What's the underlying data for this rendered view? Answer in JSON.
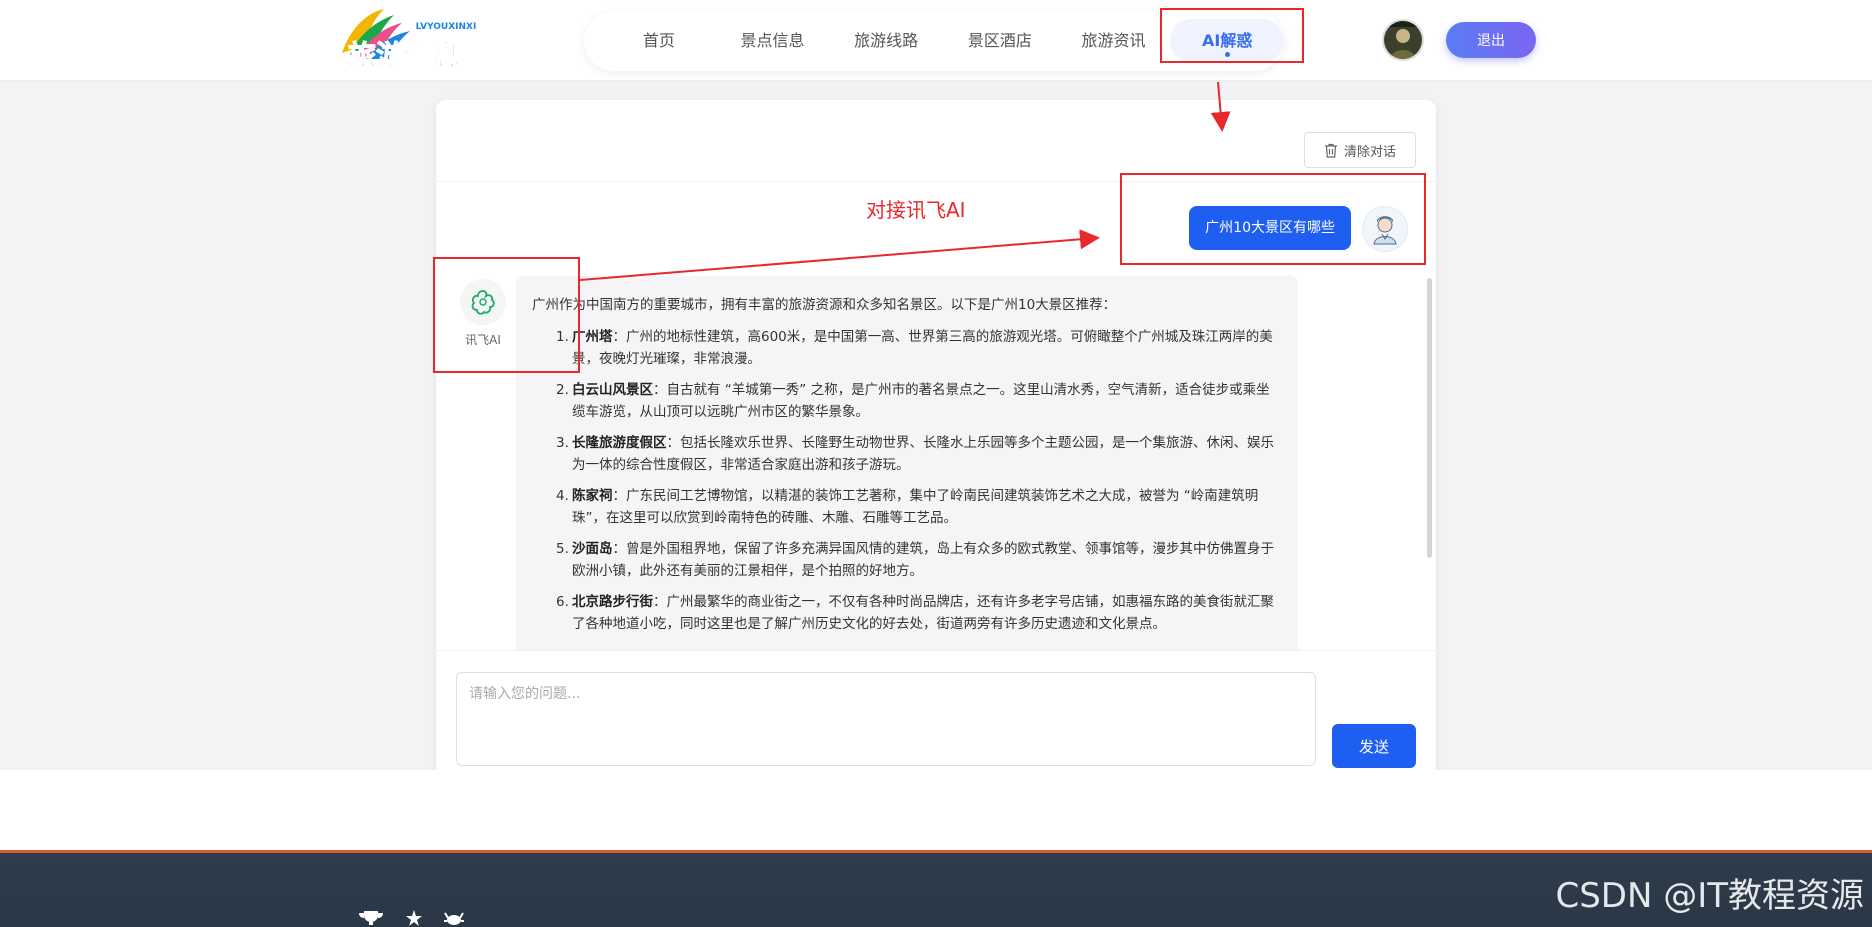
{
  "header": {
    "logo_text": "旅游信息",
    "logo_subtext": "LVYOUXINXI",
    "nav": [
      {
        "label": "首页"
      },
      {
        "label": "景点信息"
      },
      {
        "label": "旅游线路"
      },
      {
        "label": "景区酒店"
      },
      {
        "label": "旅游资讯"
      },
      {
        "label": "AI解惑"
      }
    ],
    "logout_label": "退出"
  },
  "chat": {
    "clear_label": "清除对话",
    "user_message": "广州10大景区有哪些",
    "ai_name": "讯飞AI",
    "ai_intro": "广州作为中国南方的重要城市，拥有丰富的旅游资源和众多知名景区。以下是广州10大景区推荐：",
    "ai_items": [
      {
        "num": "1.",
        "title": "广州塔",
        "text": "：广州的地标性建筑，高600米，是中国第一高、世界第三高的旅游观光塔。可俯瞰整个广州城及珠江两岸的美景，夜晚灯光璀璨，非常浪漫。"
      },
      {
        "num": "2.",
        "title": "白云山风景区",
        "text": "：自古就有 “羊城第一秀” 之称，是广州市的著名景点之一。这里山清水秀，空气清新，适合徒步或乘坐缆车游览，从山顶可以远眺广州市区的繁华景象。"
      },
      {
        "num": "3.",
        "title": "长隆旅游度假区",
        "text": "：包括长隆欢乐世界、长隆野生动物世界、长隆水上乐园等多个主题公园，是一个集旅游、休闲、娱乐为一体的综合性度假区，非常适合家庭出游和孩子游玩。"
      },
      {
        "num": "4.",
        "title": "陈家祠",
        "text": "：广东民间工艺博物馆，以精湛的装饰工艺著称，集中了岭南民间建筑装饰艺术之大成，被誉为 “岭南建筑明珠”，在这里可以欣赏到岭南特色的砖雕、木雕、石雕等工艺品。"
      },
      {
        "num": "5.",
        "title": "沙面岛",
        "text": "：曾是外国租界地，保留了许多充满异国风情的建筑，岛上有众多的欧式教堂、领事馆等，漫步其中仿佛置身于欧洲小镇，此外还有美丽的江景相伴，是个拍照的好地方。"
      },
      {
        "num": "6.",
        "title": "北京路步行街",
        "text": "：广州最繁华的商业街之一，不仅有各种时尚品牌店，还有许多老字号店铺，如惠福东路的美食街就汇聚了各种地道小吃，同时这里也是了解广州历史文化的好去处，街道两旁有许多历史遗迹和文化景点。"
      }
    ],
    "input_placeholder": "请输入您的问题...",
    "send_label": "发送"
  },
  "annotation": {
    "label": "对接讯飞AI",
    "color": "#e8282b"
  },
  "watermark": "CSDN @IT教程资源"
}
